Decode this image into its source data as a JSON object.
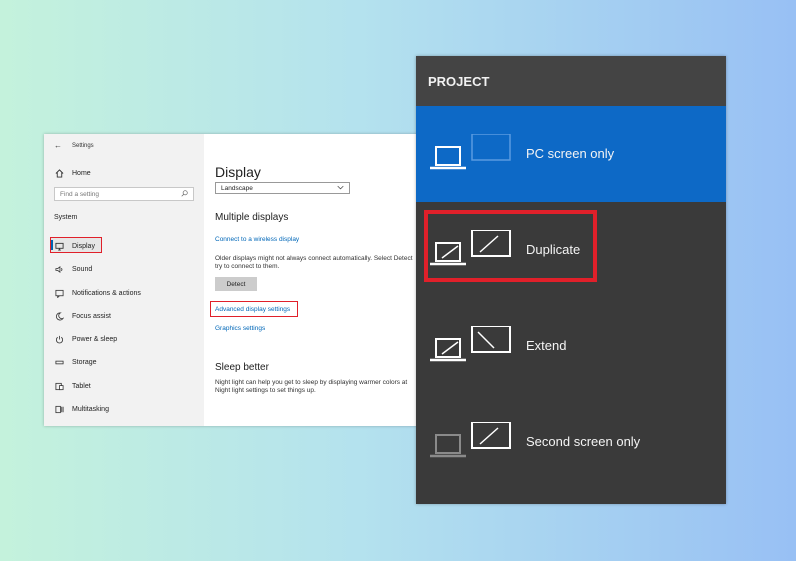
{
  "settings": {
    "title": "Settings",
    "back_glyph": "←",
    "home": "Home",
    "search_placeholder": "Find a setting",
    "section": "System",
    "nav": [
      {
        "label": "Display",
        "icon": "monitor-icon"
      },
      {
        "label": "Sound",
        "icon": "speaker-icon"
      },
      {
        "label": "Notifications & actions",
        "icon": "notification-icon"
      },
      {
        "label": "Focus assist",
        "icon": "moon-icon"
      },
      {
        "label": "Power & sleep",
        "icon": "power-icon"
      },
      {
        "label": "Storage",
        "icon": "storage-icon"
      },
      {
        "label": "Tablet",
        "icon": "tablet-icon"
      },
      {
        "label": "Multitasking",
        "icon": "multitasking-icon"
      }
    ],
    "main": {
      "heading": "Display",
      "orientation_value": "Landscape",
      "multiple_displays_heading": "Multiple displays",
      "connect_link": "Connect to a wireless display",
      "older_displays_text_1": "Older displays might not always connect automatically. Select Detect",
      "older_displays_text_2": "try to connect to them.",
      "detect_button": "Detect",
      "advanced_link": "Advanced display settings",
      "graphics_link": "Graphics settings",
      "sleep_heading": "Sleep better",
      "night_light_text_1": "Night light can help you get to sleep by displaying warmer colors at",
      "night_light_text_2": "Night light settings to set things up."
    }
  },
  "project": {
    "title": "PROJECT",
    "options": [
      {
        "label": "PC screen only",
        "selected": true
      },
      {
        "label": "Duplicate",
        "selected": false,
        "highlighted": true
      },
      {
        "label": "Extend",
        "selected": false
      },
      {
        "label": "Second screen only",
        "selected": false
      }
    ]
  },
  "colors": {
    "accent_blue": "#0d69c6",
    "highlight_red": "#e0202a",
    "panel_bg": "#3a3a3a",
    "link_blue": "#0067b8"
  }
}
